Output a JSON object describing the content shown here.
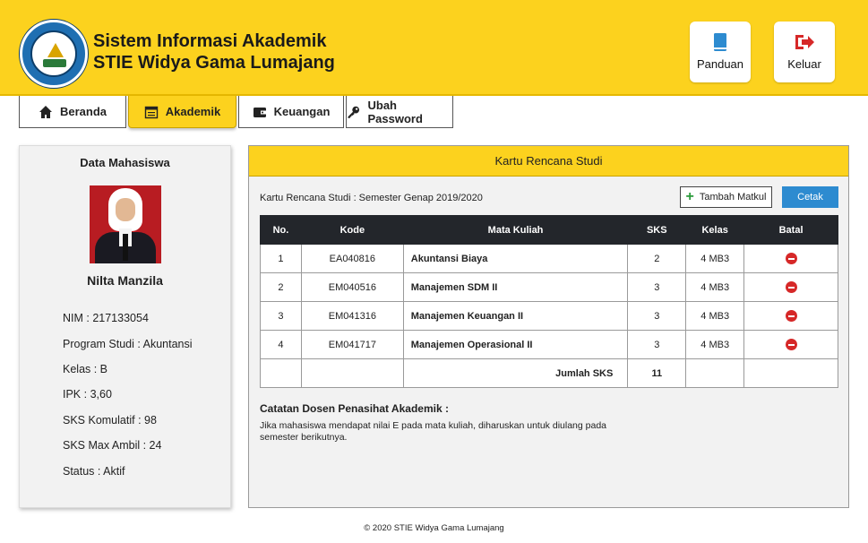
{
  "header": {
    "title_line1": "Sistem Informasi Akademik",
    "title_line2": "STIE Widya Gama Lumajang",
    "buttons": [
      {
        "label": "Panduan",
        "icon": "book-icon",
        "color": "#2d8bd0"
      },
      {
        "label": "Keluar",
        "icon": "logout-icon",
        "color": "#d62828"
      }
    ]
  },
  "nav": {
    "tabs": [
      {
        "label": "Beranda",
        "icon": "home-icon",
        "active": false
      },
      {
        "label": "Akademik",
        "icon": "calendar-icon",
        "active": true
      },
      {
        "label": "Keuangan",
        "icon": "wallet-icon",
        "active": false
      },
      {
        "label": "Ubah Password",
        "icon": "key-icon",
        "active": false
      }
    ]
  },
  "student": {
    "section_title": "Data Mahasiswa",
    "name": "Nilta Manzila",
    "details": [
      "NIM : 217133054",
      "Program Studi : Akuntansi",
      "Kelas : B",
      "IPK : 3,60",
      "SKS Komulatif : 98",
      "SKS Max Ambil : 24",
      "Status : Aktif"
    ]
  },
  "krs": {
    "title": "Kartu Rencana Studi",
    "subtitle": "Kartu Rencana Studi : Semester Genap 2019/2020",
    "add_button": "Tambah Matkul",
    "print_button": "Cetak",
    "columns": [
      "No.",
      "Kode",
      "Mata Kuliah",
      "SKS",
      "Kelas",
      "Batal"
    ],
    "rows": [
      {
        "no": "1",
        "kode": "EA040816",
        "matkul": "Akuntansi Biaya",
        "sks": "2",
        "kelas": "4 MB3"
      },
      {
        "no": "2",
        "kode": "EM040516",
        "matkul": "Manajemen SDM II",
        "sks": "3",
        "kelas": "4 MB3"
      },
      {
        "no": "3",
        "kode": "EM041316",
        "matkul": "Manajemen Keuangan II",
        "sks": "3",
        "kelas": "4 MB3"
      },
      {
        "no": "4",
        "kode": "EM041717",
        "matkul": "Manajemen Operasional II",
        "sks": "3",
        "kelas": "4 MB3"
      }
    ],
    "total_label": "Jumlah SKS",
    "total_value": "11",
    "note_title": "Catatan Dosen Penasihat Akademik :",
    "note_body": "Jika mahasiswa mendapat nilai E pada mata kuliah, diharuskan untuk diulang pada semester berikutnya."
  },
  "footer": {
    "text": "© 2020 STIE Widya Gama Lumajang"
  },
  "colors": {
    "accent": "#fcd21e",
    "table_header": "#23262b",
    "primary_button": "#2d8bd0",
    "danger": "#d62828"
  }
}
